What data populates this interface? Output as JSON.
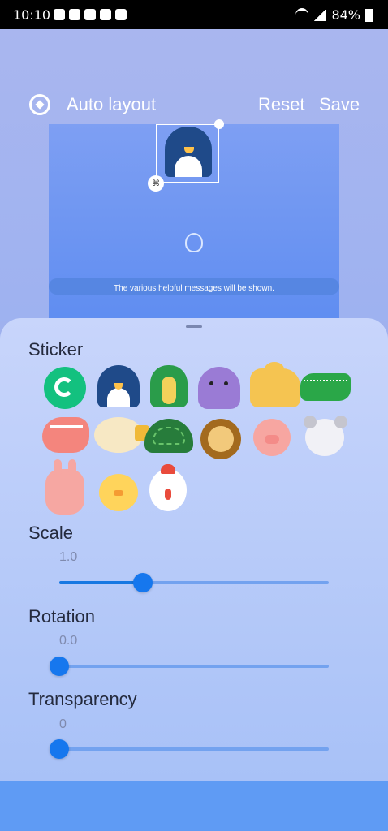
{
  "status_bar": {
    "time": "10:10",
    "battery": "84%",
    "icons": [
      "twitter-icon",
      "instagram-icon",
      "lock-icon",
      "image-icon",
      "heart-icon",
      "wifi-icon",
      "signal-icon",
      "battery-icon"
    ]
  },
  "header": {
    "auto_layout_label": "Auto layout",
    "reset_label": "Reset",
    "save_label": "Save"
  },
  "preview": {
    "message": "The various helpful messages will be shown."
  },
  "sticker_section": {
    "title": "Sticker",
    "items": [
      "refresh",
      "penguin",
      "cobra",
      "octopus",
      "camel",
      "crocodile",
      "shrimp",
      "pufferfish",
      "turtle",
      "lion",
      "pig",
      "mouse",
      "rabbit",
      "chick",
      "chicken"
    ]
  },
  "scale": {
    "title": "Scale",
    "value": "1.0",
    "level": 0.31
  },
  "rotation": {
    "title": "Rotation",
    "value": "0.0",
    "level": 0.0
  },
  "transparency": {
    "title": "Transparency",
    "value": "0",
    "level": 0.0
  },
  "colors": {
    "accent": "#1677ee",
    "track": "#73a2ef",
    "sheet": "#c8d5fb",
    "preview": "#6f95f2"
  }
}
